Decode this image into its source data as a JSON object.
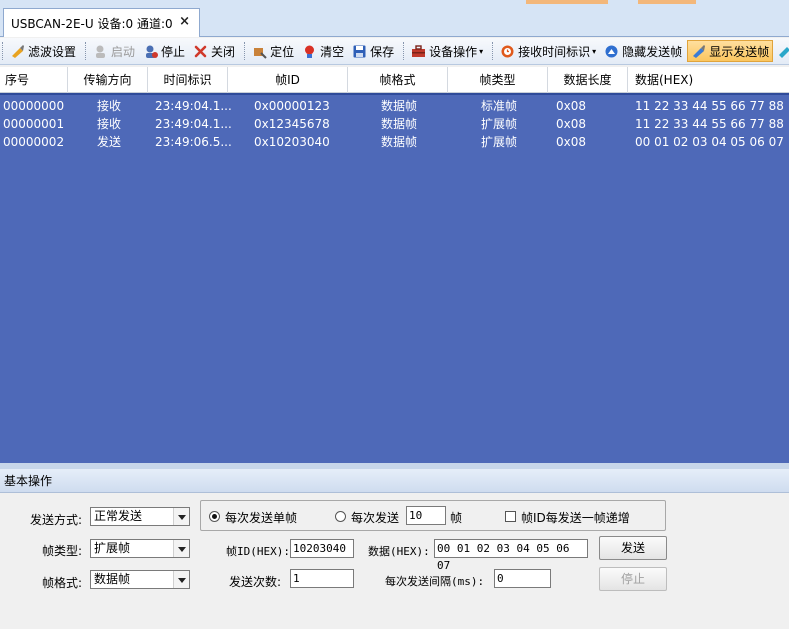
{
  "tab": {
    "label": "USBCAN-2E-U 设备:0 通道:0",
    "close": "×"
  },
  "toolbar": {
    "filter": "滤波设置",
    "start": "启动",
    "stop": "停止",
    "close": "关闭",
    "locate": "定位",
    "clear": "清空",
    "save": "保存",
    "device_ops": "设备操作",
    "recv_timestamp": "接收时间标识",
    "hide_send": "隐藏发送帧",
    "show_send": "显示发送帧"
  },
  "columns": [
    "序号",
    "传输方向",
    "时间标识",
    "帧ID",
    "帧格式",
    "帧类型",
    "数据长度",
    "数据(HEX)"
  ],
  "rows": [
    [
      "00000000",
      "接收",
      "23:49:04.1...",
      "0x00000123",
      "数据帧",
      "标准帧",
      "0x08",
      "11 22 33 44 55 66 77 88"
    ],
    [
      "00000001",
      "接收",
      "23:49:04.1...",
      "0x12345678",
      "数据帧",
      "扩展帧",
      "0x08",
      "11 22 33 44 55 66 77 88"
    ],
    [
      "00000002",
      "发送",
      "23:49:06.5...",
      "0x10203040",
      "数据帧",
      "扩展帧",
      "0x08",
      "00 01 02 03 04 05 06 07"
    ]
  ],
  "panel": {
    "title": "基本操作",
    "send_mode_label": "发送方式:",
    "send_mode_value": "正常发送",
    "frame_type_label": "帧类型:",
    "frame_type_value": "扩展帧",
    "frame_format_label": "帧格式:",
    "frame_format_value": "数据帧",
    "single_frame": "每次发送单帧",
    "multi_frame_prefix": "每次发送",
    "multi_frame_count": "10",
    "multi_frame_suffix": "帧",
    "id_increment": "帧ID每发送一帧递增",
    "frame_id_label": "帧ID(HEX):",
    "frame_id_value": "10203040",
    "data_label": "数据(HEX):",
    "data_value": "00 01 02 03 04 05 06 07",
    "send_count_label": "发送次数:",
    "send_count_value": "1",
    "interval_label": "每次发送间隔(ms):",
    "interval_value": "0",
    "send_button": "发送",
    "stop_button": "停止"
  }
}
